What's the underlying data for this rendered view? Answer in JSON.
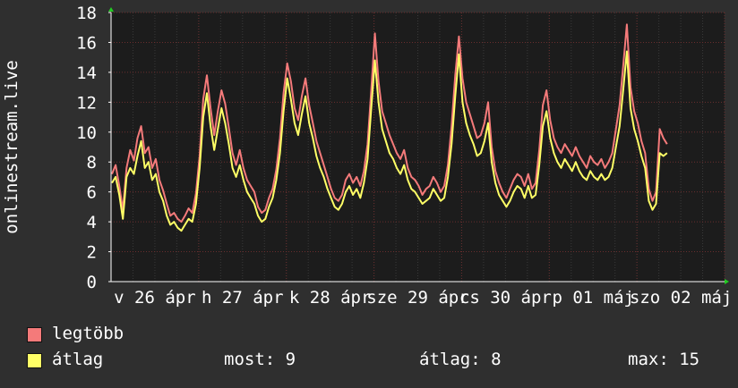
{
  "colors": {
    "background": "#2f2f2f",
    "plot_background": "#1c1c1c",
    "grid_major": "#6a2e2e",
    "grid_minor": "#3a3a3a",
    "max_series": "#f47a7a",
    "avg_series": "#ffff66",
    "axis_arrow": "#22cc22"
  },
  "legend": {
    "max_label": "legtöbb",
    "avg_label": "átlag",
    "now_label": "most:",
    "now_value": "9",
    "avg_stat_label": "átlag:",
    "avg_stat_value": "8",
    "max_stat_label": "max:",
    "max_stat_value": "15"
  },
  "chart_data": {
    "type": "line",
    "ylabel": "onlinestream.live",
    "ylim": [
      0,
      18
    ],
    "yticks": [
      0,
      2,
      4,
      6,
      8,
      10,
      12,
      14,
      16,
      18
    ],
    "x_tick_labels": [
      "v 26 ápr",
      "h 27 ápr",
      "k 28 ápr",
      "sze 29 ápr",
      "cs 30 ápr",
      "p 01 máj",
      "szo 02 máj"
    ],
    "grid": true,
    "legend_position": "bottom",
    "x_days": [
      "v 26 ápr",
      "h 27 ápr",
      "k 28 ápr",
      "sze 29 ápr",
      "cs 30 ápr",
      "p 01 máj",
      "szo 02 máj"
    ],
    "samples_per_day": 24,
    "series": [
      {
        "name": "legtöbb",
        "values": [
          7.2,
          7.8,
          6.4,
          4.8,
          7.6,
          8.8,
          8.1,
          9.6,
          10.4,
          8.6,
          9.0,
          7.6,
          8.2,
          6.8,
          6.1,
          5.2,
          4.4,
          4.6,
          4.2,
          4.0,
          4.4,
          4.9,
          4.6,
          5.9,
          8.4,
          12.2,
          13.8,
          11.6,
          9.8,
          11.4,
          12.8,
          11.9,
          10.3,
          8.6,
          7.8,
          8.8,
          7.6,
          6.8,
          6.4,
          6.0,
          5.0,
          4.6,
          4.8,
          5.6,
          6.2,
          7.5,
          9.6,
          12.6,
          14.6,
          13.4,
          11.6,
          10.8,
          12.4,
          13.6,
          11.8,
          10.6,
          9.4,
          8.6,
          7.8,
          7.0,
          6.2,
          5.6,
          5.4,
          5.8,
          6.8,
          7.2,
          6.6,
          7.0,
          6.4,
          7.4,
          9.2,
          12.8,
          16.6,
          13.4,
          11.4,
          10.6,
          9.8,
          9.2,
          8.6,
          8.2,
          8.8,
          7.6,
          7.0,
          6.8,
          6.4,
          5.8,
          6.2,
          6.4,
          7.0,
          6.6,
          6.0,
          6.4,
          7.8,
          10.4,
          13.8,
          16.4,
          13.6,
          12.0,
          11.2,
          10.4,
          9.6,
          9.8,
          10.6,
          12.0,
          9.0,
          7.4,
          6.6,
          6.0,
          5.6,
          6.2,
          6.8,
          7.2,
          7.0,
          6.4,
          7.2,
          6.2,
          6.6,
          8.8,
          11.8,
          12.8,
          10.8,
          9.6,
          9.0,
          8.6,
          9.2,
          8.8,
          8.4,
          9.0,
          8.4,
          8.0,
          7.6,
          8.4,
          8.0,
          7.8,
          8.2,
          7.6,
          8.0,
          8.6,
          10.2,
          11.8,
          14.4,
          17.2,
          13.0,
          11.4,
          10.6,
          9.4,
          8.6,
          6.2,
          5.4,
          6.0,
          10.2,
          9.6,
          9.2
        ]
      },
      {
        "name": "átlag",
        "values": [
          6.6,
          7.0,
          5.8,
          4.2,
          7.0,
          7.6,
          7.2,
          8.4,
          9.4,
          7.6,
          8.0,
          6.8,
          7.2,
          6.0,
          5.4,
          4.4,
          3.8,
          4.0,
          3.6,
          3.4,
          3.8,
          4.2,
          4.0,
          5.2,
          7.6,
          11.0,
          12.6,
          10.4,
          8.8,
          10.2,
          11.6,
          10.6,
          9.2,
          7.6,
          7.0,
          7.8,
          6.8,
          6.0,
          5.6,
          5.2,
          4.4,
          4.0,
          4.2,
          5.0,
          5.6,
          6.8,
          8.6,
          11.4,
          13.6,
          12.2,
          10.6,
          9.8,
          11.2,
          12.4,
          10.6,
          9.6,
          8.4,
          7.6,
          7.0,
          6.2,
          5.6,
          5.0,
          4.8,
          5.2,
          6.0,
          6.4,
          5.8,
          6.2,
          5.6,
          6.6,
          8.2,
          11.6,
          14.8,
          12.0,
          10.2,
          9.4,
          8.6,
          8.2,
          7.6,
          7.2,
          7.8,
          6.8,
          6.2,
          6.0,
          5.6,
          5.2,
          5.4,
          5.6,
          6.2,
          5.8,
          5.4,
          5.6,
          7.0,
          9.2,
          12.4,
          15.2,
          12.0,
          10.6,
          9.8,
          9.2,
          8.4,
          8.6,
          9.4,
          10.6,
          8.0,
          6.6,
          5.8,
          5.4,
          5.0,
          5.4,
          6.0,
          6.4,
          6.2,
          5.6,
          6.4,
          5.6,
          5.8,
          7.8,
          10.4,
          11.4,
          9.6,
          8.6,
          8.0,
          7.6,
          8.2,
          7.8,
          7.4,
          8.0,
          7.4,
          7.0,
          6.8,
          7.4,
          7.0,
          6.8,
          7.2,
          6.8,
          7.0,
          7.6,
          9.0,
          10.4,
          12.8,
          15.4,
          11.6,
          10.2,
          9.4,
          8.4,
          7.6,
          5.4,
          4.8,
          5.2,
          8.6,
          8.4,
          8.6
        ]
      }
    ]
  }
}
